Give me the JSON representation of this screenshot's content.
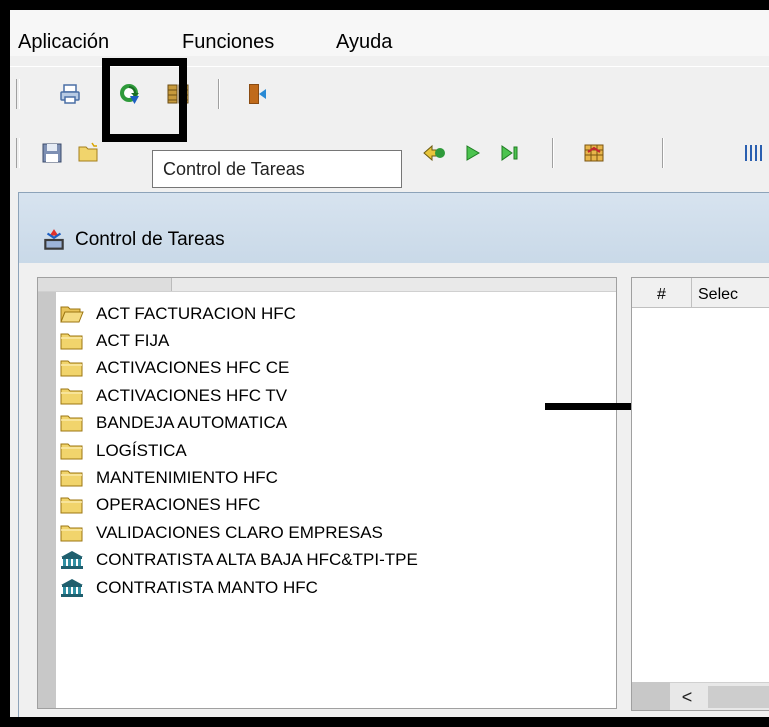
{
  "menu": {
    "items": [
      "Aplicación",
      "Funciones",
      "Ayuda"
    ]
  },
  "toolbar1": {
    "icons": [
      "printer-icon",
      "refresh-task-icon",
      "grid-list-icon",
      "exit-door-icon"
    ]
  },
  "toolbar2": {
    "icons": [
      "save-icon",
      "open-folder-icon",
      "back-icon",
      "play-icon",
      "play-end-icon",
      "transfer-icon",
      "columns-icon"
    ]
  },
  "tooltip": {
    "text": "Control de Tareas"
  },
  "child_window": {
    "title": "Control de Tareas"
  },
  "tree": {
    "items": [
      {
        "label": "ACT FACTURACION HFC",
        "icon": "open-folder-icon"
      },
      {
        "label": "ACT FIJA",
        "icon": "folder-icon"
      },
      {
        "label": "ACTIVACIONES HFC CE",
        "icon": "folder-icon"
      },
      {
        "label": "ACTIVACIONES HFC TV",
        "icon": "folder-icon"
      },
      {
        "label": "BANDEJA AUTOMATICA",
        "icon": "folder-icon"
      },
      {
        "label": "LOGÍSTICA",
        "icon": "folder-icon"
      },
      {
        "label": "MANTENIMIENTO HFC",
        "icon": "folder-icon"
      },
      {
        "label": "OPERACIONES HFC",
        "icon": "folder-icon"
      },
      {
        "label": "VALIDACIONES CLARO EMPRESAS",
        "icon": "folder-icon"
      },
      {
        "label": "CONTRATISTA ALTA BAJA HFC&TPI-TPE",
        "icon": "bank-icon"
      },
      {
        "label": "CONTRATISTA MANTO HFC",
        "icon": "bank-icon"
      }
    ]
  },
  "grid": {
    "columns": [
      "#",
      "Selec"
    ],
    "scroll_left": "<"
  },
  "colors": {
    "title_gradient_top": "#d7e3ef",
    "title_gradient_bottom": "#c9d9e8",
    "folder_yellow": "#f1d46c",
    "bank_teal": "#1f5f6e"
  }
}
